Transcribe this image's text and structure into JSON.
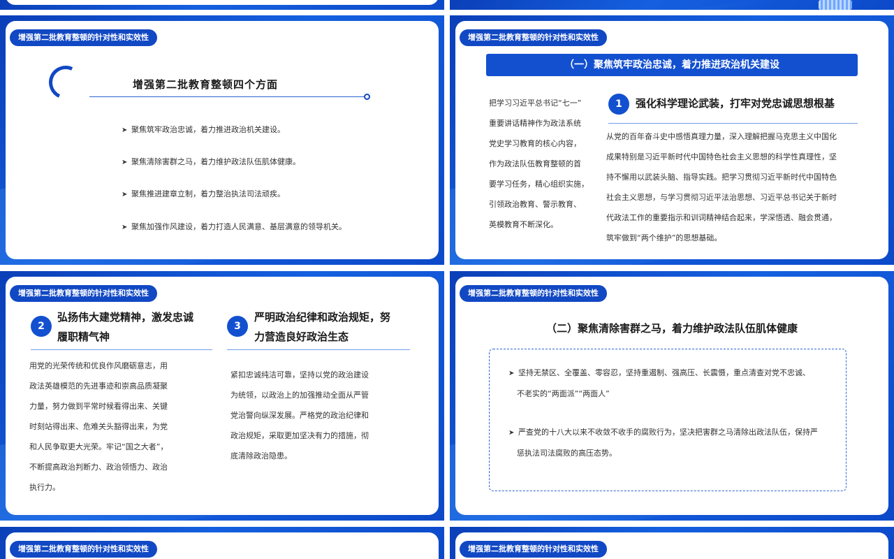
{
  "tag": "增强第二批教育整顿的针对性和实效性",
  "slide1": {
    "title": "增强第二批教育整顿四个方面",
    "bullets": [
      "聚焦筑牢政治忠诚，着力推进政治机关建设。",
      "聚焦清除害群之马，着力维护政法队伍肌体健康。",
      "聚焦推进建章立制，着力整治执法司法顽疾。",
      "聚焦加强作风建设，着力打造人民满意、基层满意的领导机关。"
    ]
  },
  "slide2": {
    "banner": "（一）聚焦筑牢政治忠诚，着力推进政治机关建设",
    "left_lines": [
      "把学习习近平总书记“七一”",
      "重要讲话精神作为政法系统",
      "党史学习教育的核心内容，",
      "作为政法队伍教育整顿的首",
      "要学习任务，精心组织实施，",
      "引领政治教育、警示教育、",
      "英模教育不断深化。"
    ],
    "number": "1",
    "heading": "强化科学理论武装，打牢对党忠诚思想根基",
    "body_lines": [
      "从党的百年奋斗史中感悟真理力量，深入理解把握马克思主义中国化",
      "成果特别是习近平新时代中国特色社会主义思想的科学性真理性，坚",
      "持不懈用以武装头脑、指导实践。把学习贯彻习近平新时代中国特色",
      "社会主义思想，与学习贯彻习近平法治思想、习近平总书记关于新时",
      "代政法工作的重要指示和训词精神结合起来，学深悟透、融会贯通，",
      "筑牢做到“两个维护”的思想基础。"
    ]
  },
  "slide3": {
    "col1": {
      "number": "2",
      "heading_lines": [
        "弘扬伟大建党精神，激发忠诚",
        "履职精气神"
      ],
      "body_lines": [
        "用党的光荣传统和优良作风磨砺意志，用",
        "政法英雄模范的先进事迹和崇高品质凝聚",
        "力量，努力做到平常时候看得出来、关键",
        "时刻站得出来、危难关头豁得出来，为党",
        "和人民争取更大光荣。牢记“国之大者”，",
        "不断提高政治判断力、政治领悟力、政治",
        "执行力。"
      ]
    },
    "col2": {
      "number": "3",
      "heading_lines": [
        "严明政治纪律和政治规矩，努",
        "力营造良好政治生态"
      ],
      "body_lines": [
        "紧扣忠诚纯洁可靠，坚持以党的政治建设",
        "为统领，以政治上的加强推动全面从严管",
        "党治警向纵深发展。严格党的政治纪律和",
        "政治规矩，采取更加坚决有力的措施，彻",
        "底清除政治隐患。"
      ]
    }
  },
  "slide4": {
    "title": "（二）聚焦清除害群之马，着力维护政法队伍肌体健康",
    "items": [
      [
        "坚持无禁区、全覆盖、零容忍，坚持重遏制、强高压、长震慑，重点清查对党不忠诚、",
        "不老实的“两面派”“两面人”"
      ],
      [
        "严查党的十八大以来不收敛不收手的腐败行为，坚决把害群之马清除出政法队伍，保持严",
        "惩执法司法腐败的高压态势。"
      ]
    ]
  }
}
